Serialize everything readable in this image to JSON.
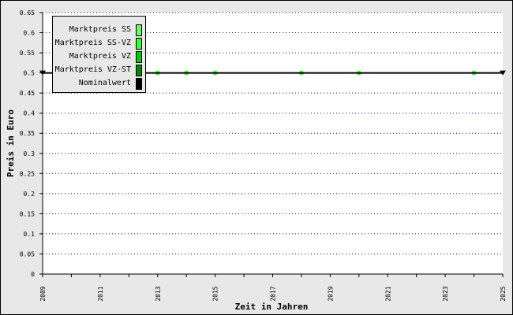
{
  "chart_data": {
    "type": "scatter",
    "xlabel": "Zeit in Jahren",
    "ylabel": "Preis in Euro",
    "xlim": [
      2009,
      2025
    ],
    "ylim": [
      0,
      0.65
    ],
    "x_ticks": [
      2009,
      2011,
      2013,
      2015,
      2017,
      2019,
      2021,
      2023,
      2025
    ],
    "y_ticks": [
      "0",
      "0.05",
      "0.1",
      "0.15",
      "0.2",
      "0.25",
      "0.3",
      "0.35",
      "0.4",
      "0.45",
      "0.5",
      "0.55",
      "0.6",
      "0.65"
    ],
    "grid": "horizontal dotted",
    "legend_position": "top-left",
    "series": [
      {
        "name": "Marktpreis SS",
        "color": "#66ff66",
        "points": []
      },
      {
        "name": "Marktpreis SS-VZ",
        "color": "#33ff33",
        "points": [
          [
            2013,
            0.5
          ],
          [
            2014,
            0.5
          ],
          [
            2015,
            0.5
          ],
          [
            2018,
            0.5
          ],
          [
            2020,
            0.5
          ],
          [
            2024,
            0.5
          ]
        ]
      },
      {
        "name": "Marktpreis VZ",
        "color": "#00cc00",
        "points": []
      },
      {
        "name": "Marktpreis VZ-ST",
        "color": "#008800",
        "points": []
      },
      {
        "name": "Nominalwert",
        "color": "#000000",
        "line": [
          [
            2009,
            0.5
          ],
          [
            2025,
            0.5
          ]
        ]
      }
    ]
  }
}
